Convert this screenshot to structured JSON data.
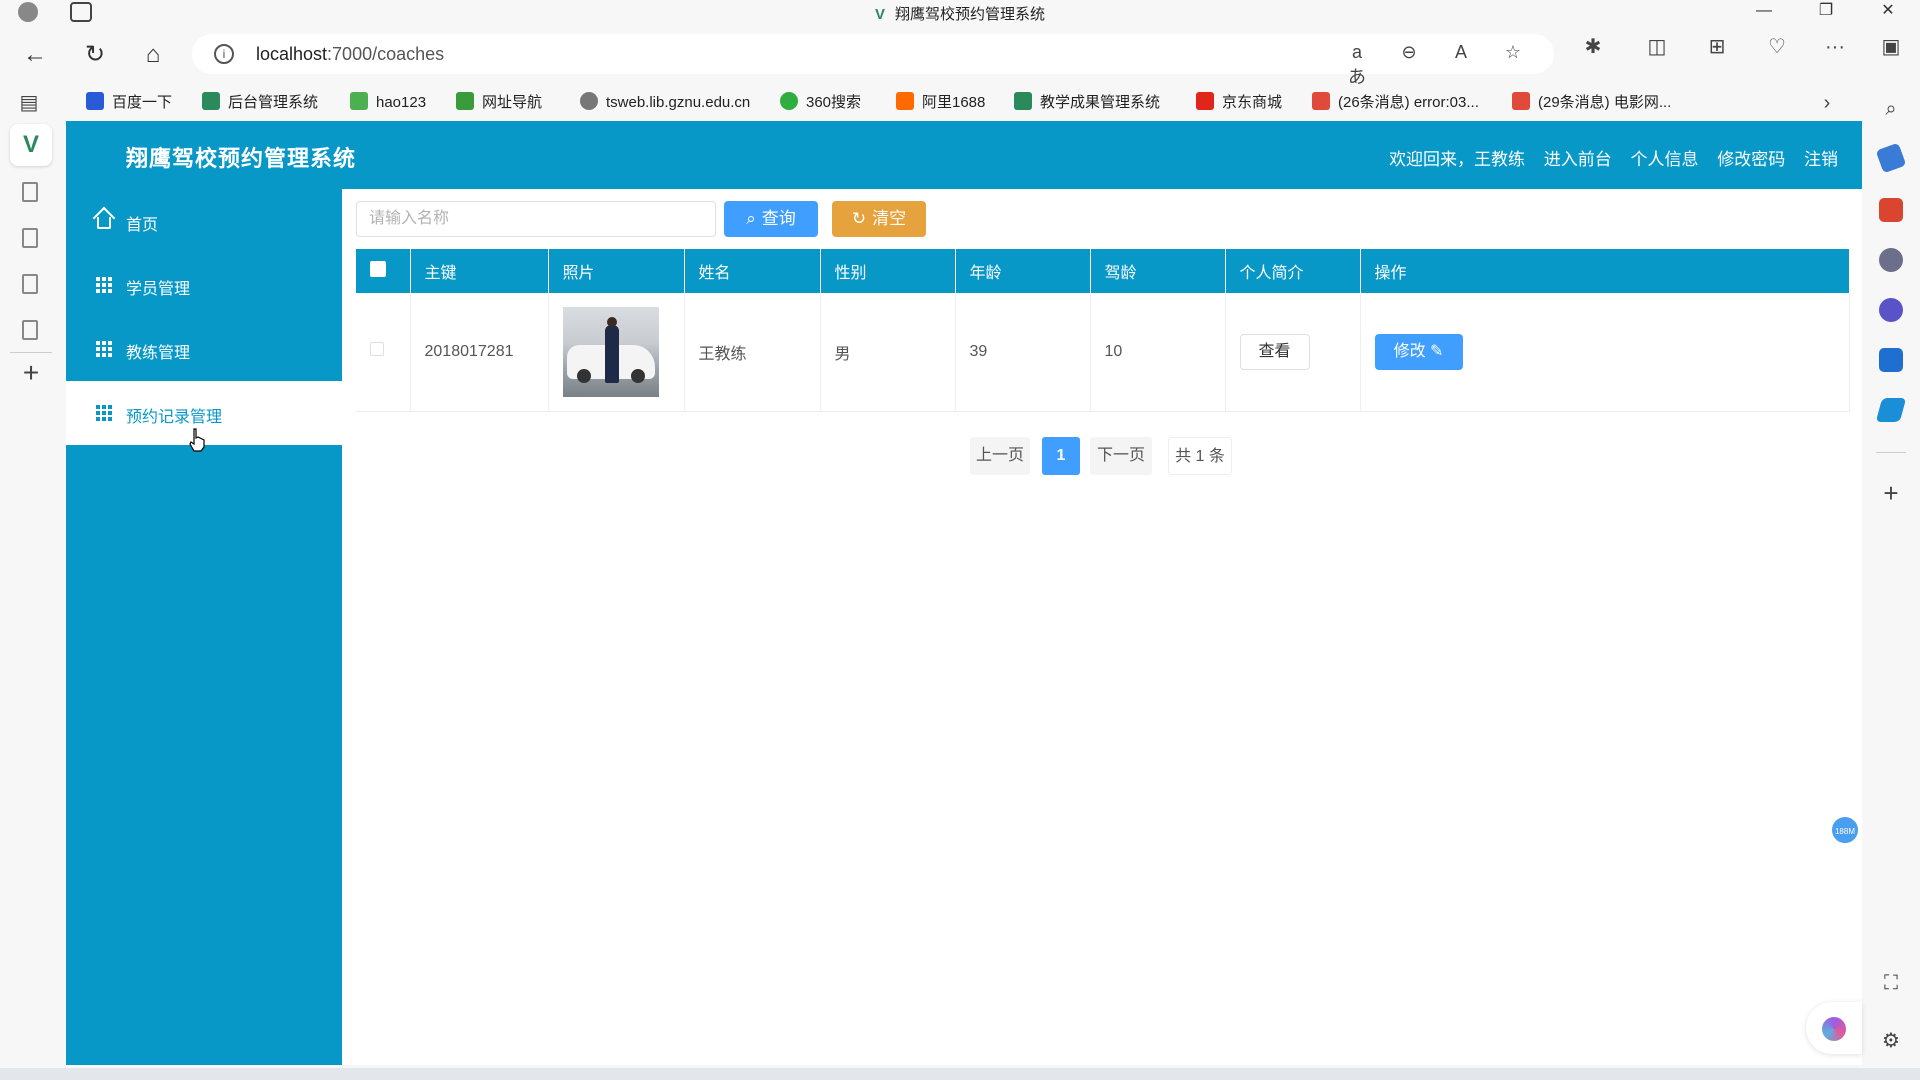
{
  "browser": {
    "window_title": "翔鹰驾校预约管理系统",
    "url_host": "localhost",
    "url_path": ":7000/coaches",
    "bookmarks": [
      {
        "label": "百度一下",
        "color": "#2a5bd7"
      },
      {
        "label": "后台管理系统",
        "color": "#2a8a5b"
      },
      {
        "label": "hao123",
        "color": "#4caf50"
      },
      {
        "label": "网址导航",
        "color": "#3a9b3a"
      },
      {
        "label": "tsweb.lib.gznu.edu.cn",
        "color": "#777777"
      },
      {
        "label": "360搜索",
        "color": "#2fae3f"
      },
      {
        "label": "阿里1688",
        "color": "#ff6a00"
      },
      {
        "label": "教学成果管理系统",
        "color": "#2a8a5b"
      },
      {
        "label": "京东商城",
        "color": "#e1251b"
      },
      {
        "label": "(26条消息) error:03...",
        "color": "#e04a3a"
      },
      {
        "label": "(29条消息) 电影网...",
        "color": "#e04a3a"
      }
    ]
  },
  "app": {
    "title": "翔鹰驾校预约管理系统",
    "header_links": [
      "欢迎回来，王教练",
      "进入前台",
      "个人信息",
      "修改密码",
      "注销"
    ],
    "menu": [
      {
        "label": "首页",
        "icon": "home-icon",
        "active": false
      },
      {
        "label": "学员管理",
        "icon": "grid-icon",
        "active": false
      },
      {
        "label": "教练管理",
        "icon": "grid-icon",
        "active": false
      },
      {
        "label": "预约记录管理",
        "icon": "grid-icon",
        "active": true
      }
    ],
    "search": {
      "placeholder": "请输入名称",
      "query_label": "查询",
      "clear_label": "清空"
    },
    "table": {
      "headers": [
        "主键",
        "照片",
        "姓名",
        "性别",
        "年龄",
        "驾龄",
        "个人简介",
        "操作"
      ],
      "rows": [
        {
          "id": "2018017281",
          "name": "王教练",
          "gender": "男",
          "age": "39",
          "years_driving": "10",
          "view_label": "查看",
          "edit_label": "修改"
        }
      ]
    },
    "pagination": {
      "prev": "上一页",
      "current": "1",
      "next": "下一页",
      "total": "共 1 条"
    },
    "colors": {
      "primary": "#0898c8",
      "query_button": "#409eff",
      "clear_button": "#e6a23c"
    }
  },
  "overlay": {
    "memory_badge": "188M"
  }
}
